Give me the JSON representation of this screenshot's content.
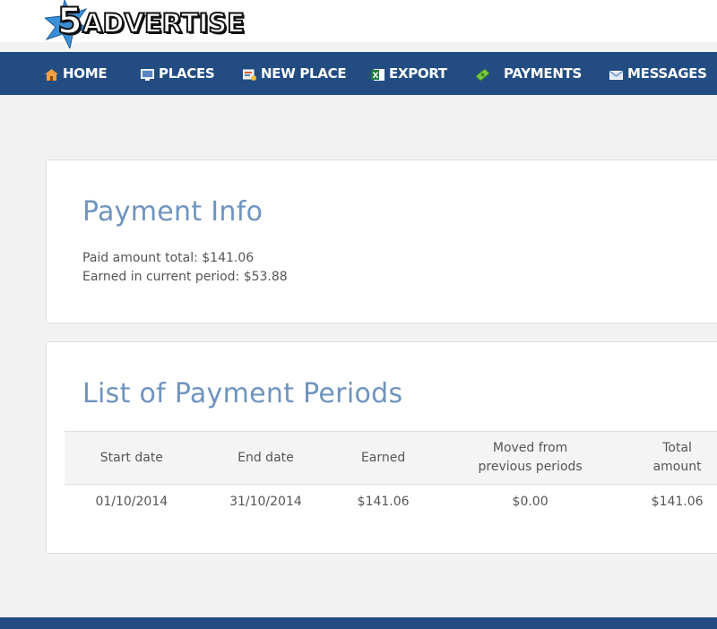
{
  "brand": {
    "five": "5",
    "name": "ADVERTISE"
  },
  "nav": {
    "items": [
      {
        "label": "HOME",
        "icon": "home-icon"
      },
      {
        "label": "PLACES",
        "icon": "monitor-icon"
      },
      {
        "label": "NEW PLACE",
        "icon": "new-place-icon"
      },
      {
        "label": "EXPORT",
        "icon": "excel-icon"
      },
      {
        "label": "PAYMENTS",
        "icon": "money-icon"
      },
      {
        "label": "MESSAGES",
        "icon": "envelope-icon"
      }
    ]
  },
  "payment_info": {
    "title": "Payment Info",
    "paid_total": "Paid amount total: $141.06",
    "earned_current": "Earned in current period: $53.88"
  },
  "periods": {
    "title": "List of Payment Periods",
    "headers": {
      "start": "Start date",
      "end": "End date",
      "earned": "Earned",
      "moved_l1": "Moved from",
      "moved_l2": "previous periods",
      "total_l1": "Total",
      "total_l2": "amount"
    },
    "rows": [
      {
        "start": "01/10/2014",
        "end": "31/10/2014",
        "earned": "$141.06",
        "moved": "$0.00",
        "total": "$141.06"
      }
    ]
  },
  "colors": {
    "nav_bg": "#234d82",
    "title_blue": "#6f94bf",
    "logo_blue": "#3b8fd6"
  }
}
